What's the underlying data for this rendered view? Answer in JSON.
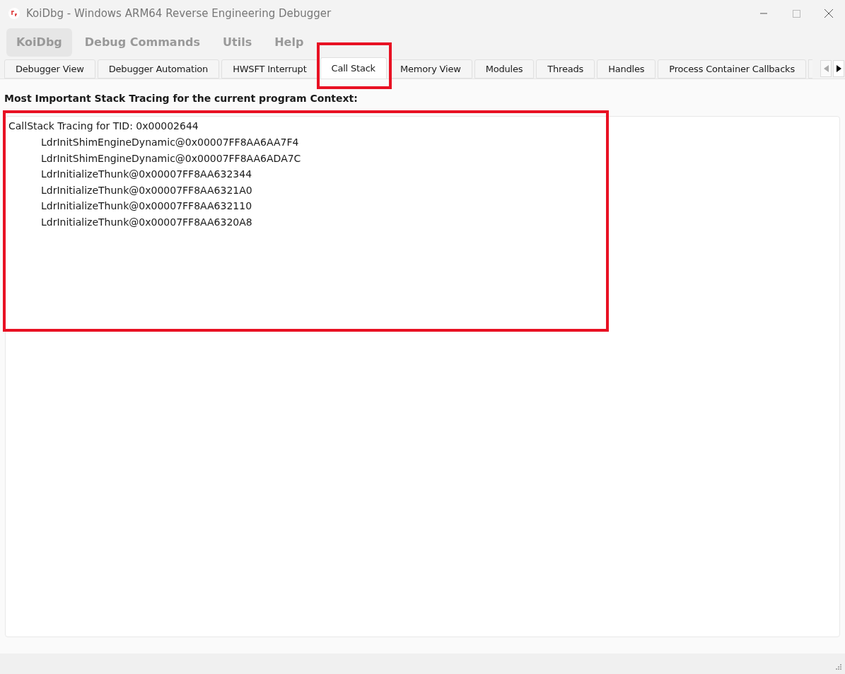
{
  "window": {
    "title": "KoiDbg - Windows ARM64 Reverse Engineering Debugger"
  },
  "menu": [
    {
      "label": "KoiDbg",
      "selected": true
    },
    {
      "label": "Debug Commands",
      "selected": false
    },
    {
      "label": "Utils",
      "selected": false
    },
    {
      "label": "Help",
      "selected": false
    }
  ],
  "tabs": [
    {
      "label": "Debugger View",
      "selected": false
    },
    {
      "label": "Debugger Automation",
      "selected": false
    },
    {
      "label": "HWSFT Interrupt",
      "selected": false
    },
    {
      "label": "Call Stack",
      "selected": true
    },
    {
      "label": "Memory View",
      "selected": false
    },
    {
      "label": "Modules",
      "selected": false
    },
    {
      "label": "Threads",
      "selected": false
    },
    {
      "label": "Handles",
      "selected": false
    },
    {
      "label": "Process Container Callbacks",
      "selected": false
    }
  ],
  "heading": "Most Important Stack Tracing for the current program Context:",
  "call_stack": {
    "header": "CallStack Tracing for TID: 0x00002644",
    "frames": [
      "LdrInitShimEngineDynamic@0x00007FF8AA6AA7F4",
      "LdrInitShimEngineDynamic@0x00007FF8AA6ADA7C",
      "LdrInitializeThunk@0x00007FF8AA632344",
      "LdrInitializeThunk@0x00007FF8AA6321A0",
      "LdrInitializeThunk@0x00007FF8AA632110",
      "LdrInitializeThunk@0x00007FF8AA6320A8"
    ]
  }
}
